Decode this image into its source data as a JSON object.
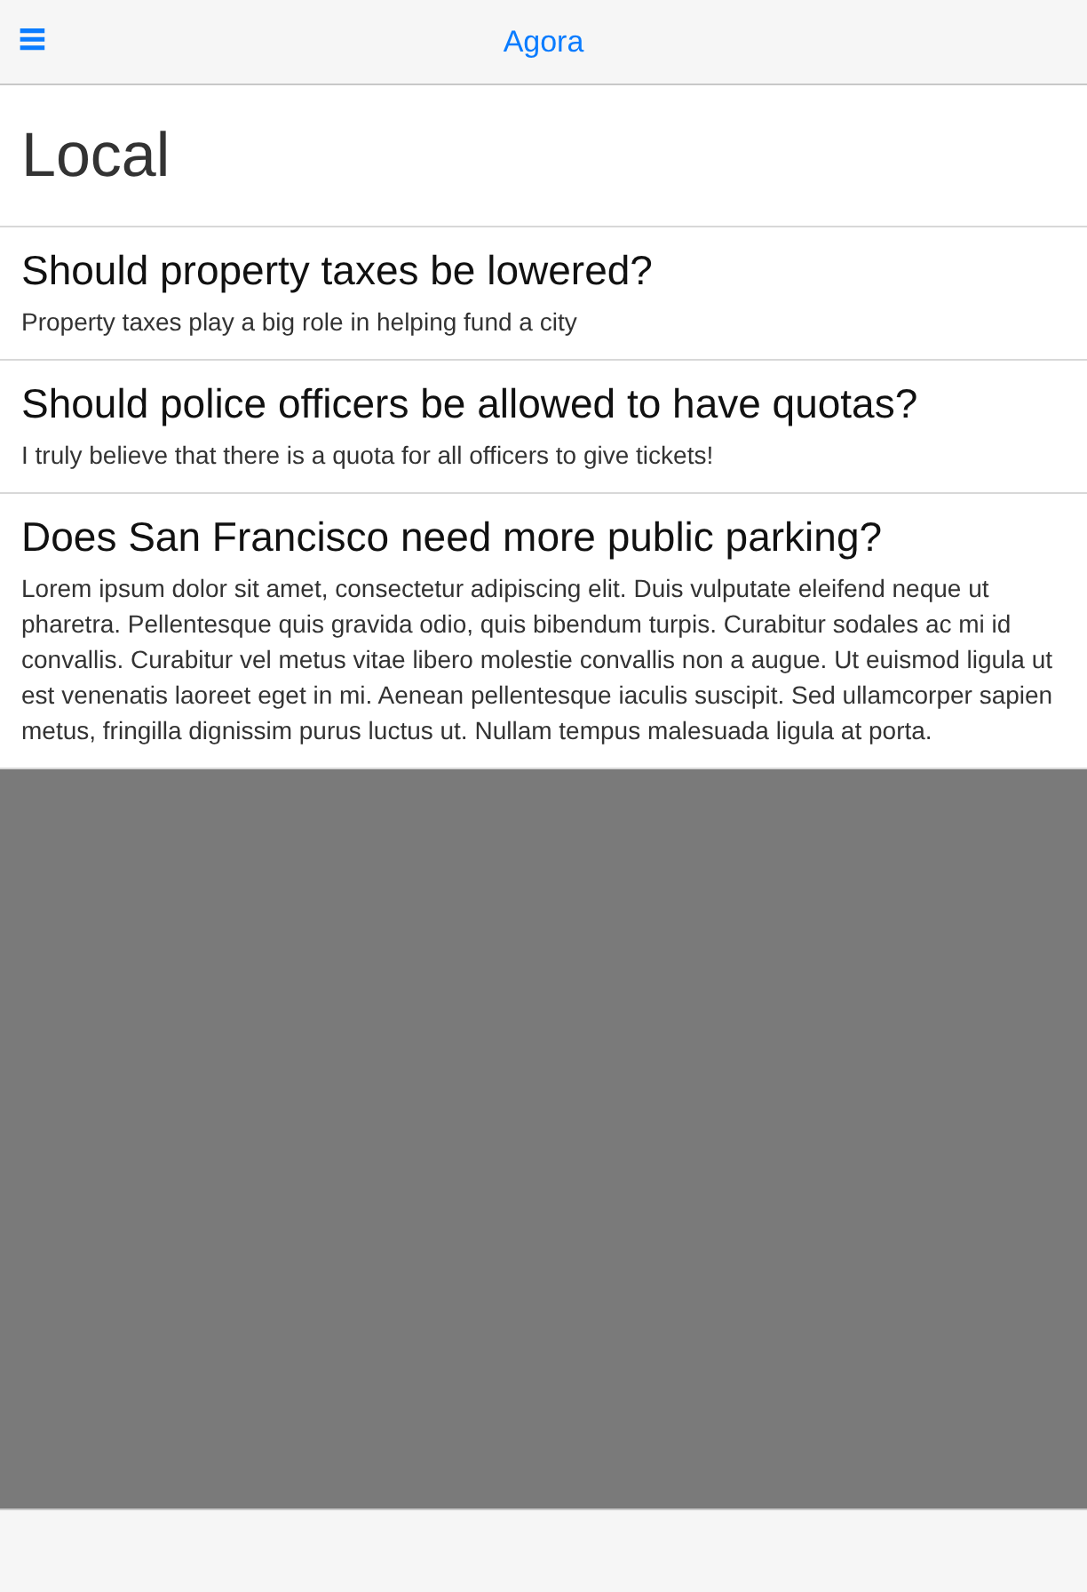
{
  "nav_bar": {
    "menu_icon": "≡",
    "title": "Agora"
  },
  "page": {
    "heading": "Local"
  },
  "questions": [
    {
      "title": "Should property taxes be lowered?",
      "summary": "Property taxes play a big role in helping fund a city"
    },
    {
      "title": "Should police officers be allowed to have quotas?",
      "summary": "I truly believe that there is a quota for all officers to give tickets!"
    },
    {
      "title": "Does San Francisco need more public parking?",
      "summary": "Lorem ipsum dolor sit amet, consectetur adipiscing elit. Duis vulputate eleifend neque ut pharetra. Pellentesque quis gravida odio, quis bibendum turpis. Curabitur sodales ac mi id convallis. Curabitur vel metus vitae libero molestie convallis non a augue. Ut euismod ligula ut est venenatis laoreet eget in mi. Aenean pellentesque iaculis suscipit. Sed ullamcorper sapien metus, fringilla dignissim purus luctus ut. Nullam tempus malesuada ligula at porta."
    }
  ]
}
